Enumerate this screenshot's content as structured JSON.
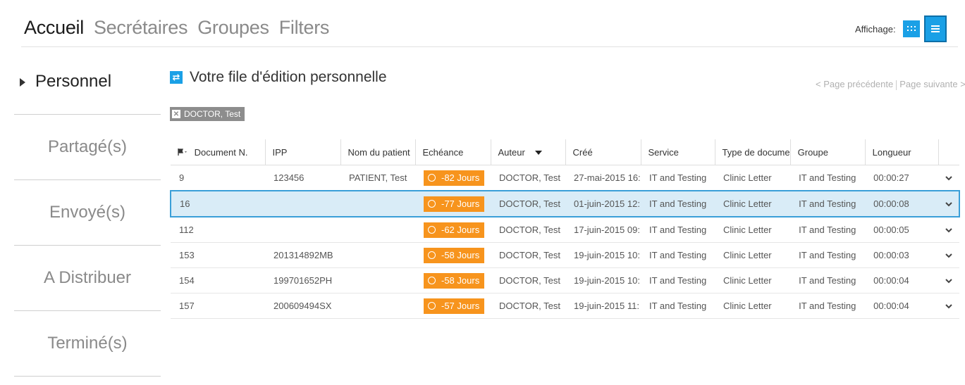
{
  "nav": {
    "tabs": [
      "Accueil",
      "Secrétaires",
      "Groupes",
      "Filters"
    ],
    "active_tab": "Accueil",
    "affichage_label": "Affichage:",
    "icons": [
      "grid-view-icon",
      "list-view-icon"
    ]
  },
  "sidebar": {
    "items": [
      {
        "label": "Personnel"
      },
      {
        "label": "Partagé(s)"
      },
      {
        "label": "Envoyé(s)"
      },
      {
        "label": "A Distribuer"
      },
      {
        "label": "Terminé(s)"
      }
    ]
  },
  "queue": {
    "title": "Votre file d'édition personnelle",
    "pager_prev": "< Page précédente",
    "pager_next": "Page suivante >",
    "filter_chip": "DOCTOR, Test"
  },
  "table": {
    "headers": [
      "Document N.",
      "IPP",
      "Nom du patient",
      "Echéance",
      "Auteur",
      "Créé",
      "Service",
      "Type de docume",
      "Groupe",
      "Longueur"
    ],
    "rows": [
      {
        "doc": "9",
        "ipp": "123456",
        "patient": "PATIENT, Test",
        "due": "-82 Jours",
        "author": "DOCTOR, Test",
        "created": "27-mai-2015 16:",
        "service": "IT and Testing",
        "type": "Clinic Letter",
        "group": "IT and Testing",
        "length": "00:00:27"
      },
      {
        "doc": "16",
        "ipp": "",
        "patient": "",
        "due": "-77 Jours",
        "author": "DOCTOR, Test",
        "created": "01-juin-2015 12:",
        "service": "IT and Testing",
        "type": "Clinic Letter",
        "group": "IT and Testing",
        "length": "00:00:08"
      },
      {
        "doc": "112",
        "ipp": "",
        "patient": "",
        "due": "-62 Jours",
        "author": "DOCTOR, Test",
        "created": "17-juin-2015 09:",
        "service": "IT and Testing",
        "type": "Clinic Letter",
        "group": "IT and Testing",
        "length": "00:00:05"
      },
      {
        "doc": "153",
        "ipp": "201314892MB",
        "patient": "",
        "due": "-58 Jours",
        "author": "DOCTOR, Test",
        "created": "19-juin-2015 10:",
        "service": "IT and Testing",
        "type": "Clinic Letter",
        "group": "IT and Testing",
        "length": "00:00:03"
      },
      {
        "doc": "154",
        "ipp": "199701652PH",
        "patient": "",
        "due": "-58 Jours",
        "author": "DOCTOR, Test",
        "created": "19-juin-2015 10:",
        "service": "IT and Testing",
        "type": "Clinic Letter",
        "group": "IT and Testing",
        "length": "00:00:04"
      },
      {
        "doc": "157",
        "ipp": "200609494SX",
        "patient": "",
        "due": "-57 Jours",
        "author": "DOCTOR, Test",
        "created": "19-juin-2015 11:",
        "service": "IT and Testing",
        "type": "Clinic Letter",
        "group": "IT and Testing",
        "length": "00:00:04"
      }
    ],
    "selected_row_index": 1
  },
  "colors": {
    "accent": "#1aa0e6",
    "due_badge": "#f7941d",
    "selected_row": "#d9ecf7",
    "chip": "#8d8d8d"
  }
}
